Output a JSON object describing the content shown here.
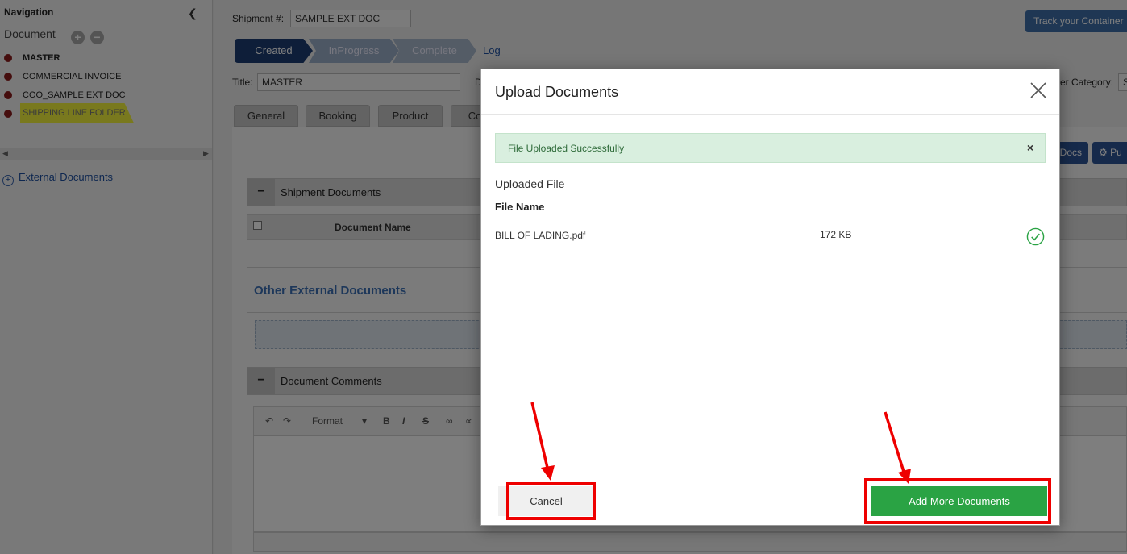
{
  "sidebar": {
    "title": "Navigation",
    "section": "Document",
    "tree": [
      {
        "label": "MASTER",
        "bold": true
      },
      {
        "label": "COMMERCIAL INVOICE"
      },
      {
        "label": "COO_SAMPLE EXT DOC"
      },
      {
        "label": "SHIPPING LINE FOLDER",
        "highlighted": true
      }
    ],
    "external_documents": "External Documents"
  },
  "header": {
    "shipment_label": "Shipment #:",
    "shipment_value": "SAMPLE EXT DOC",
    "track_button": "Track your Container",
    "title_label": "Title:",
    "title_value": "MASTER",
    "d_label": "D",
    "category_label": "er Category:",
    "category_value": "S"
  },
  "status_steps": [
    "Created",
    "InProgress",
    "Complete"
  ],
  "log_link": "Log",
  "tabs": [
    "General",
    "Booking",
    "Product",
    "Co"
  ],
  "content": {
    "shipment_documents": "Shipment Documents",
    "document_name_col": "Document Name",
    "other_external_documents": "Other External Documents",
    "document_comments": "Document Comments",
    "editor_format": "Format",
    "docs_button": "Docs",
    "pu_button": "Pu"
  },
  "modal": {
    "title": "Upload Documents",
    "alert": "File Uploaded Successfully",
    "alert_close": "×",
    "uploaded_heading": "Uploaded File",
    "file_name_header": "File Name",
    "files": [
      {
        "name": "BILL OF LADING.pdf",
        "size": "172 KB",
        "status": "check-icon"
      }
    ],
    "cancel_button": "Cancel",
    "add_more_button": "Add More Documents"
  },
  "colors": {
    "primary_blue": "#1d3d72",
    "success_green": "#2aa344",
    "alert_bg": "#d9efdf",
    "annotation_red": "#ee0000"
  }
}
